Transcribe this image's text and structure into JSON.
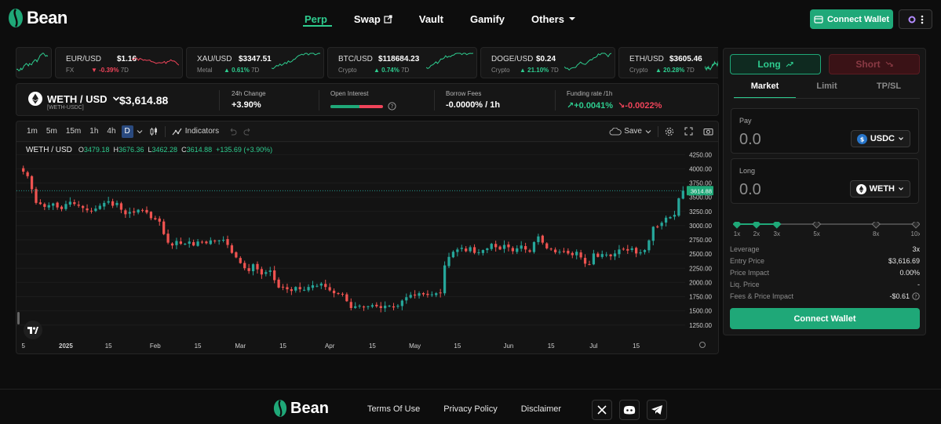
{
  "brand": {
    "name": "Bean"
  },
  "nav": {
    "items": [
      {
        "label": "Perp",
        "active": true
      },
      {
        "label": "Swap"
      },
      {
        "label": "Vault"
      },
      {
        "label": "Gamify"
      },
      {
        "label": "Others"
      }
    ],
    "connect_wallet": "Connect Wallet"
  },
  "tickers": [
    {
      "symbol": "",
      "price": "",
      "category": "",
      "change": "",
      "period": "",
      "dir": "up",
      "color": "#2ecc8f"
    },
    {
      "symbol": "EUR/USD",
      "price": "$1.16",
      "category": "FX",
      "change": "-0.39%",
      "period": "7D",
      "dir": "down",
      "color": "#f0445a"
    },
    {
      "symbol": "XAU/USD",
      "price": "$3347.51",
      "category": "Metal",
      "change": "0.61%",
      "period": "7D",
      "dir": "up",
      "color": "#2ecc8f"
    },
    {
      "symbol": "BTC/USD",
      "price": "$118684.23",
      "category": "Crypto",
      "change": "0.74%",
      "period": "7D",
      "dir": "up",
      "color": "#2ecc8f"
    },
    {
      "symbol": "DOGE/USD",
      "price": "$0.24",
      "category": "Crypto",
      "change": "21.10%",
      "period": "7D",
      "dir": "up",
      "color": "#2ecc8f"
    },
    {
      "symbol": "ETH/USD",
      "price": "$3605.46",
      "category": "Crypto",
      "change": "20.28%",
      "period": "7D",
      "dir": "up",
      "color": "#2ecc8f"
    }
  ],
  "market": {
    "pair": "WETH / USD",
    "pair_sub": "[WETH-USDC]",
    "price": "$3,614.88",
    "change_24h_label": "24h Change",
    "change_24h": "+3.90%",
    "open_interest_label": "Open Interest",
    "open_interest_long_pct": 0.55,
    "borrow_fees_label": "Borrow Fees",
    "borrow_fees": "-0.0000% / 1h",
    "funding_label": "Funding rate /1h",
    "funding_long": "+0.0041%",
    "funding_short": "-0.0022%"
  },
  "toolbar": {
    "timeframes": [
      "1m",
      "5m",
      "15m",
      "1h",
      "4h",
      "D"
    ],
    "active_timeframe": "D",
    "indicators": "Indicators",
    "save": "Save"
  },
  "chart_data": {
    "type": "candlestick",
    "title": "WETH / USD",
    "ohlc": {
      "o": "3479.18",
      "h": "3676.36",
      "l": "3462.28",
      "c": "3614.88",
      "change": "+135.69 (+3.90%)"
    },
    "last_price_label": "3614.88",
    "y_ticks": [
      "4250.00",
      "4000.00",
      "3750.00",
      "3500.00",
      "3250.00",
      "3000.00",
      "2750.00",
      "2500.00",
      "2250.00",
      "2000.00",
      "1750.00",
      "1500.00",
      "1250.00"
    ],
    "ylim": [
      1150,
      4350
    ],
    "last_price": 3614.88,
    "x_ticks": [
      {
        "label": "5",
        "index": 0
      },
      {
        "label": "2025",
        "index": 10
      },
      {
        "label": "15",
        "index": 20
      },
      {
        "label": "Feb",
        "index": 31
      },
      {
        "label": "15",
        "index": 41
      },
      {
        "label": "Mar",
        "index": 51
      },
      {
        "label": "15",
        "index": 61
      },
      {
        "label": "Apr",
        "index": 72
      },
      {
        "label": "15",
        "index": 82
      },
      {
        "label": "May",
        "index": 92
      },
      {
        "label": "15",
        "index": 102
      },
      {
        "label": "Jun",
        "index": 114
      },
      {
        "label": "15",
        "index": 124
      },
      {
        "label": "Jul",
        "index": 134
      },
      {
        "label": "15",
        "index": 144
      }
    ],
    "closes": [
      3950,
      3870,
      3640,
      3400,
      3380,
      3330,
      3360,
      3390,
      3320,
      3290,
      3380,
      3420,
      3380,
      3350,
      3310,
      3270,
      3250,
      3300,
      3350,
      3400,
      3430,
      3350,
      3400,
      3280,
      3200,
      3240,
      3230,
      3280,
      3270,
      3230,
      3130,
      3110,
      3070,
      2850,
      2700,
      2650,
      2730,
      2680,
      2680,
      2720,
      2650,
      2720,
      2710,
      2690,
      2740,
      2730,
      2740,
      2750,
      2660,
      2520,
      2440,
      2340,
      2250,
      2200,
      2320,
      2230,
      2140,
      2180,
      2210,
      2040,
      1910,
      1920,
      1880,
      1850,
      1920,
      1880,
      1870,
      1920,
      1950,
      1940,
      1980,
      1920,
      1860,
      1810,
      1800,
      1790,
      1670,
      1550,
      1580,
      1590,
      1560,
      1580,
      1600,
      1580,
      1550,
      1590,
      1590,
      1560,
      1590,
      1680,
      1740,
      1780,
      1770,
      1810,
      1790,
      1780,
      1790,
      1810,
      1810,
      2300,
      2450,
      2540,
      2580,
      2610,
      2550,
      2620,
      2520,
      2530,
      2570,
      2600,
      2680,
      2620,
      2580,
      2660,
      2620,
      2550,
      2600,
      2650,
      2580,
      2540,
      2710,
      2810,
      2700,
      2600,
      2590,
      2530,
      2540,
      2550,
      2510,
      2480,
      2540,
      2440,
      2330,
      2320,
      2510,
      2450,
      2500,
      2490,
      2460,
      2510,
      2580,
      2590,
      2560,
      2600,
      2510,
      2530,
      2570,
      2740,
      2980,
      2980,
      3050,
      3140,
      3150,
      3190,
      3480,
      3614
    ]
  },
  "trade": {
    "long": "Long",
    "short": "Short",
    "order_tabs": [
      "Market",
      "Limit",
      "TP/SL"
    ],
    "pay_label": "Pay",
    "pay_amount": "0.0",
    "pay_token": "USDC",
    "long_label": "Long",
    "long_amount": "0.0",
    "long_token": "WETH",
    "leverage_marks": [
      "1x",
      "2x",
      "3x",
      "5x",
      "8x",
      "10x"
    ],
    "leverage_selected": 3,
    "rows": [
      {
        "k": "Leverage",
        "v": "3x"
      },
      {
        "k": "Entry Price",
        "v": "$3,616.69"
      },
      {
        "k": "Price Impact",
        "v": "0.00%"
      },
      {
        "k": "Liq. Price",
        "v": "-"
      },
      {
        "k": "Fees & Price Impact",
        "v": "-$0.61"
      }
    ],
    "connect_wallet": "Connect Wallet"
  },
  "footer": {
    "links": [
      "Terms Of Use",
      "Privacy Policy",
      "Disclaimer"
    ],
    "socials": [
      "x-icon",
      "discord-icon",
      "telegram-icon"
    ]
  }
}
